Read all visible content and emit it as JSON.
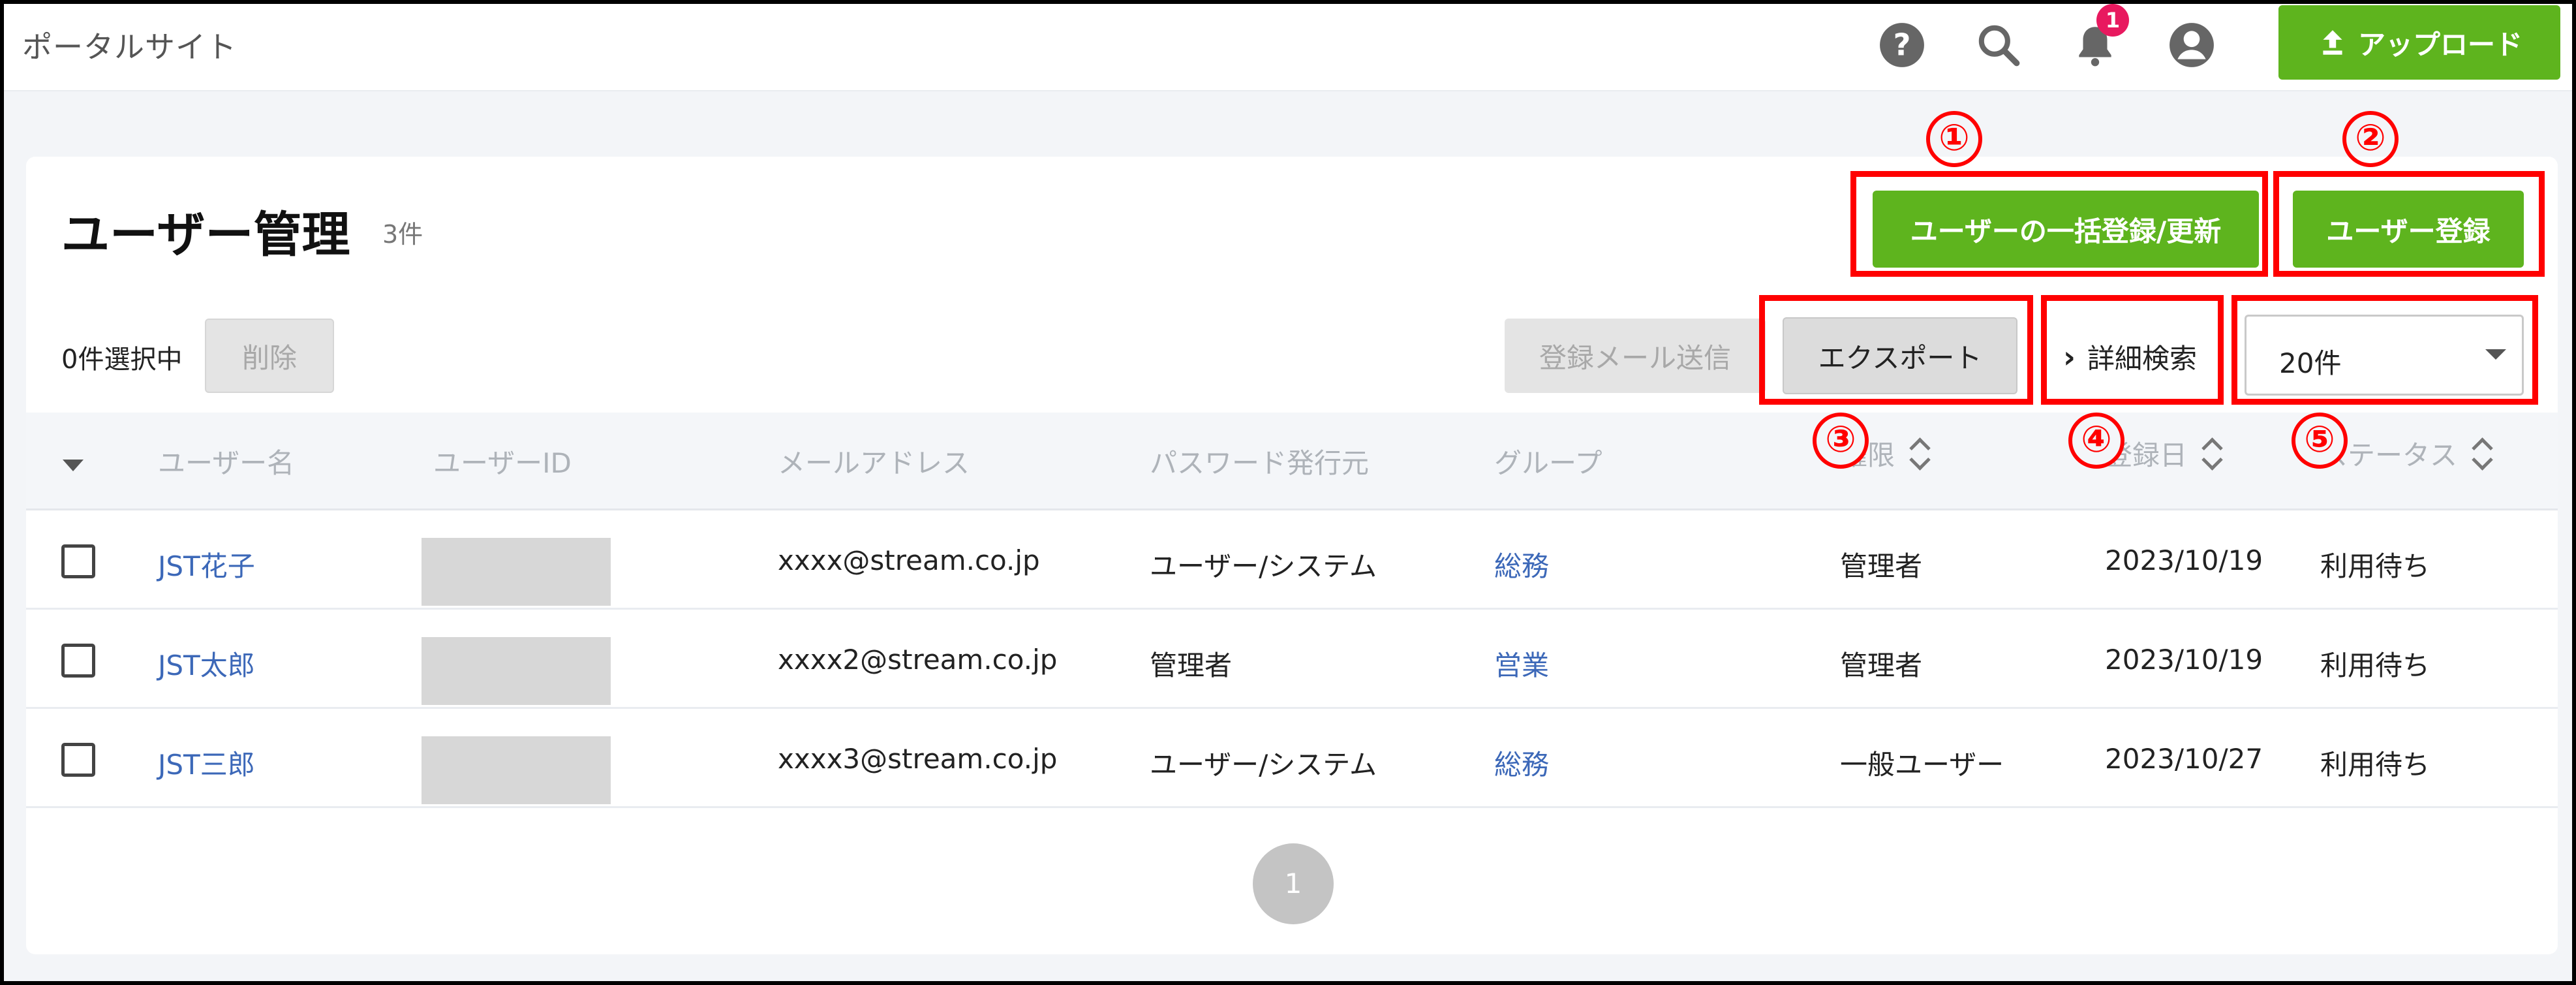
{
  "header": {
    "brand": "ポータルサイト",
    "notification_count": "1",
    "upload_label": "アップロード",
    "icons": [
      "help-icon",
      "search-icon",
      "bell-icon",
      "account-icon",
      "upload-icon"
    ]
  },
  "page": {
    "title": "ユーザー管理",
    "count": "3件",
    "bulk_button": "ユーザーの一括登録/更新",
    "register_button": "ユーザー登録",
    "selected_text": "0件選択中",
    "delete_button": "削除",
    "send_mail_button": "登録メール送信",
    "export_button": "エクスポート",
    "detail_search": "詳細検索",
    "per_page": "20件"
  },
  "annotations": [
    "①",
    "②",
    "③",
    "④",
    "⑤"
  ],
  "table": {
    "columns": [
      "ユーザー名",
      "ユーザーID",
      "メールアドレス",
      "パスワード発行元",
      "グループ",
      "権限",
      "登録日",
      "ステータス"
    ],
    "rows": [
      {
        "name": "JST花子",
        "email": "xxxx@stream.co.jp",
        "issuer": "ユーザー/システム",
        "group": "総務",
        "role": "管理者",
        "date": "2023/10/19",
        "status": "利用待ち"
      },
      {
        "name": "JST太郎",
        "email": "xxxx2@stream.co.jp",
        "issuer": "管理者",
        "group": "営業",
        "role": "管理者",
        "date": "2023/10/19",
        "status": "利用待ち"
      },
      {
        "name": "JST三郎",
        "email": "xxxx3@stream.co.jp",
        "issuer": "ユーザー/システム",
        "group": "総務",
        "role": "一般ユーザー",
        "date": "2023/10/27",
        "status": "利用待ち"
      }
    ]
  },
  "pagination": {
    "current": "1"
  },
  "colors": {
    "accent_green": "#5eb41e",
    "link_blue": "#3c68b8",
    "annotation_red": "#ff0000",
    "badge_pink": "#e8195f"
  }
}
